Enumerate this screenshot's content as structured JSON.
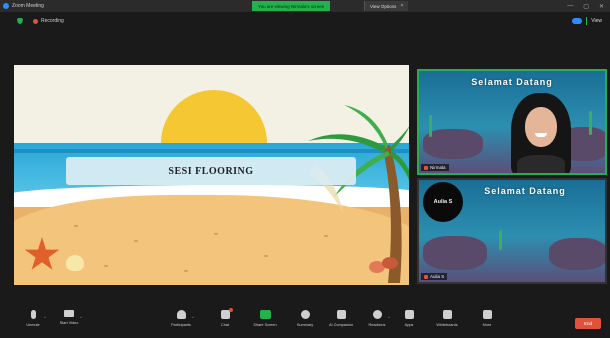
{
  "window": {
    "app_title": "Zoom Meeting",
    "share_banner": "You are viewing Nirmala's screen",
    "view_options": "View Options",
    "close_glyph": "×",
    "controls": [
      "—",
      "▢",
      "✕"
    ]
  },
  "meeting": {
    "recording_label": "Recording",
    "view_label": "View"
  },
  "shared_screen": {
    "banner_text": "SESI FLOORING",
    "colors": {
      "sky": "#f3f1e4",
      "sun": "#f5c733",
      "sea": "#2aa6d6",
      "sand": "#f2c47c"
    }
  },
  "participants": [
    {
      "tile_title": "Selamat Datang",
      "name": "Nirmala"
    },
    {
      "tile_title": "Selamat Datang",
      "avatar_text": "Aulia S",
      "name": "Aulia S"
    }
  ],
  "toolbar": {
    "items": [
      {
        "label": "Unmute",
        "icon": "microphone-icon"
      },
      {
        "label": "Start Video",
        "icon": "video-camera-icon"
      },
      {
        "label": "Participants",
        "icon": "participants-icon"
      },
      {
        "label": "Chat",
        "icon": "chat-icon"
      },
      {
        "label": "Share Screen",
        "icon": "share-screen-icon"
      },
      {
        "label": "Summary",
        "icon": "summary-icon"
      },
      {
        "label": "AI Companion",
        "icon": "ai-companion-icon"
      },
      {
        "label": "Reactions",
        "icon": "reactions-icon"
      },
      {
        "label": "Apps",
        "icon": "apps-icon"
      },
      {
        "label": "Whiteboards",
        "icon": "whiteboard-icon"
      },
      {
        "label": "More",
        "icon": "more-icon"
      }
    ],
    "end_label": "End",
    "colors": {
      "share": "#22b14c",
      "end": "#e0533a"
    }
  }
}
